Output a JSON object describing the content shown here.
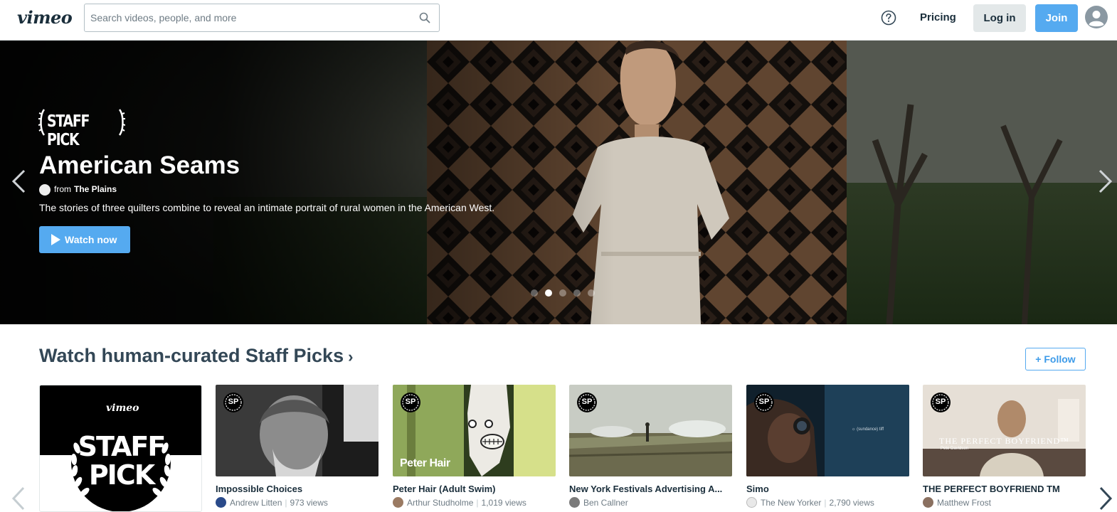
{
  "nav": {
    "logo": "vimeo",
    "search_placeholder": "Search videos, people, and more",
    "pricing": "Pricing",
    "login": "Log in",
    "join": "Join"
  },
  "hero": {
    "badge": "STAFF PICK",
    "title": "American Seams",
    "from_label": "from",
    "owner": "The Plains",
    "description": "The stories of three quilters combine to reveal an intimate portrait of rural women in the American West.",
    "watch_label": "Watch now",
    "slides": 5,
    "active_slide": 2
  },
  "staff_picks": {
    "title": "Watch human-curated Staff Picks",
    "chevron": "›",
    "follow_label": "+ Follow",
    "promo": {
      "brand": "vimeo",
      "line1": "STAFF",
      "line2": "PICK"
    },
    "videos": [
      {
        "title": "Impossible Choices",
        "author": "Andrew Litten",
        "views": "973 views",
        "badge": "SP"
      },
      {
        "title": "Peter Hair (Adult Swim)",
        "author": "Arthur Studholme",
        "views": "1,019 views",
        "badge": "SP",
        "overlay": "Peter Hair"
      },
      {
        "title": "New York Festivals Advertising A...",
        "author": "Ben Callner",
        "views": "",
        "badge": "SP"
      },
      {
        "title": "Simo",
        "author": "The New Yorker",
        "views": "2,790 views",
        "badge": "SP"
      },
      {
        "title": "THE PERFECT BOYFRIEND TM",
        "author": "Matthew Frost",
        "views": "",
        "badge": "SP",
        "overlay": "THE PERFECT BOYFRIEND™",
        "overlay_sub": "Pete Davidson"
      }
    ]
  },
  "colors": {
    "accent": "#55aaf0",
    "text": "#1a2e3b",
    "heading": "#334756"
  }
}
